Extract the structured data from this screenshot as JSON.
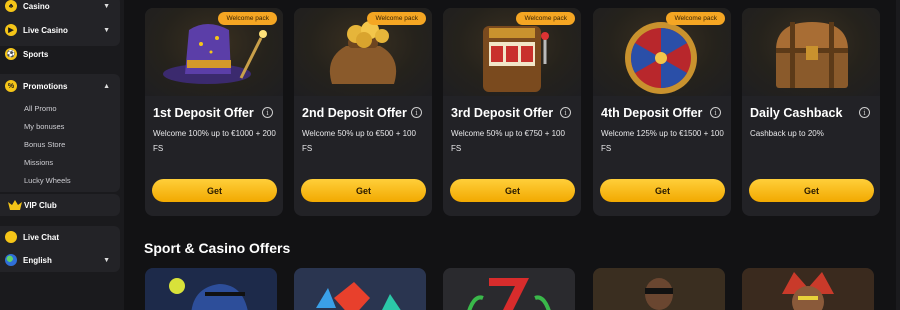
{
  "sidebar": {
    "items": {
      "casino": "Casino",
      "live_casino": "Live Casino",
      "sports": "Sports",
      "promotions": "Promotions",
      "vip_club": "VIP Club",
      "live_chat": "Live Chat",
      "language": "English"
    },
    "promotions_sub": [
      "All Promo",
      "My bonuses",
      "Bonus Store",
      "Missions",
      "Lucky Wheels"
    ]
  },
  "offers": [
    {
      "badge": "Welcome pack",
      "title": "1st Deposit Offer",
      "desc": "Welcome 100% up to €1000 + 200 FS",
      "button": "Get",
      "art_icon": "wizard-hat-icon"
    },
    {
      "badge": "Welcome pack",
      "title": "2nd Deposit Offer",
      "desc": "Welcome 50% up to €500 + 100 FS",
      "button": "Get",
      "art_icon": "coin-sack-icon"
    },
    {
      "badge": "Welcome pack",
      "title": "3rd Deposit Offer",
      "desc": "Welcome 50% up to €750 + 100 FS",
      "button": "Get",
      "art_icon": "slot-machine-icon"
    },
    {
      "badge": "Welcome pack",
      "title": "4th Deposit Offer",
      "desc": "Welcome 125% up to €1500 + 100 FS",
      "button": "Get",
      "art_icon": "prize-wheel-icon"
    },
    {
      "badge": "",
      "title": "Daily Cashback",
      "desc": "Cashback up to 20%",
      "button": "Get",
      "art_icon": "treasure-chest-icon"
    }
  ],
  "section": {
    "title": "Sport & Casino Offers"
  },
  "colors": {
    "accent": "#f5c518",
    "badge": "#f5a623",
    "card_bg": "#222226",
    "page_bg": "#121214"
  }
}
